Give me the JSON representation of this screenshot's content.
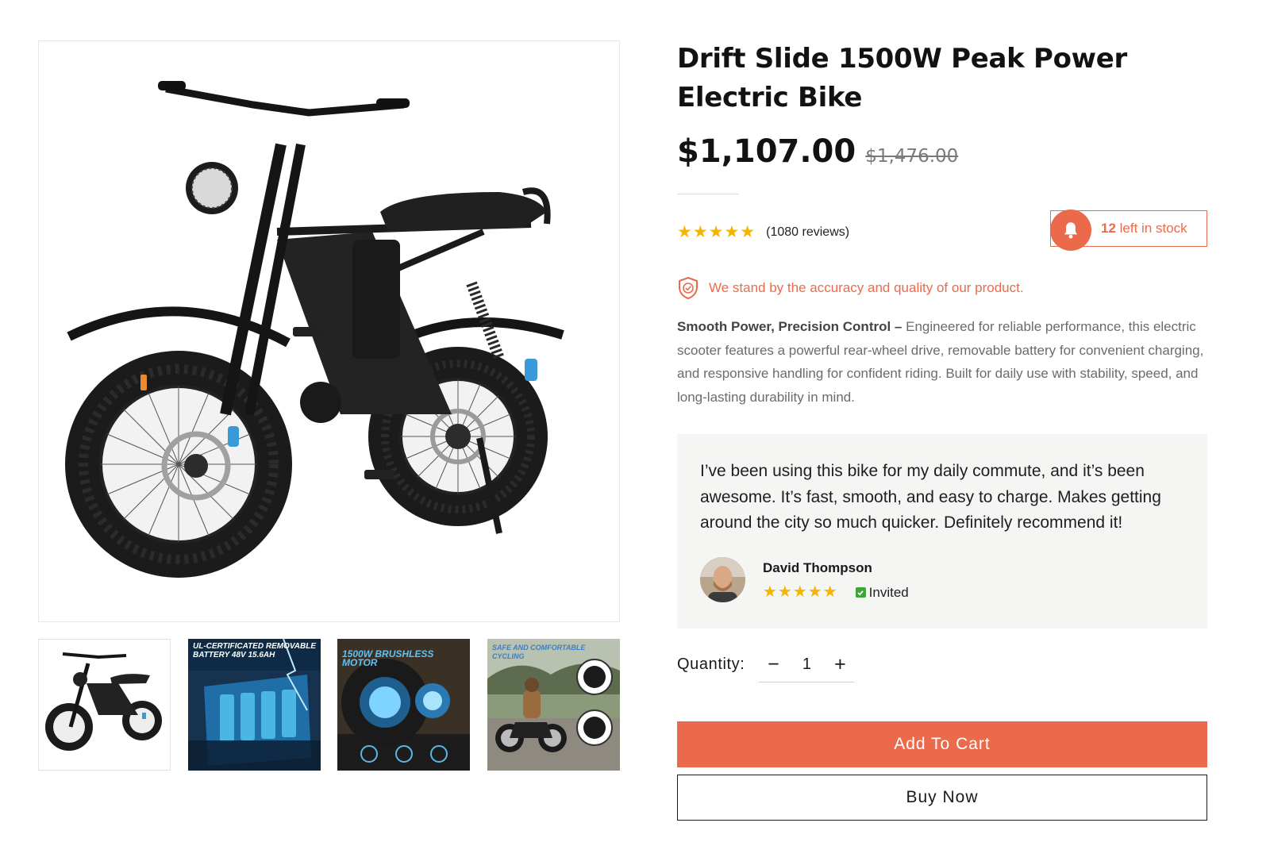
{
  "product": {
    "title": "Drift Slide 1500W Peak Power Electric Bike",
    "price": "$1,107.00",
    "compare_price": "$1,476.00"
  },
  "rating": {
    "stars": "★★★★★",
    "value": 5,
    "review_count": "(1080 reviews)"
  },
  "stock": {
    "count": "12",
    "text": " left in stock"
  },
  "trust": {
    "text": "We stand by the accuracy and quality of our product."
  },
  "description": {
    "lead": "Smooth Power, Precision Control –",
    "body": " Engineered for reliable performance, this electric scooter features a powerful rear-wheel drive, removable battery for convenient charging, and responsive handling for confident riding. Built for daily use with stability, speed, and long-lasting durability in mind."
  },
  "testimonial": {
    "quote": "I’ve been using this bike for my daily commute, and it’s been awesome. It’s fast, smooth, and easy to charge. Makes getting around the city so much quicker. Definitely recommend it!",
    "author": "David Thompson",
    "stars": "★★★★★",
    "badge": "Invited"
  },
  "quantity": {
    "label": "Quantity:",
    "value": "1",
    "minus": "−",
    "plus": "+"
  },
  "buttons": {
    "add_to_cart": "Add To Cart",
    "buy_now": "Buy Now"
  },
  "thumbnails": [
    {
      "caption": ""
    },
    {
      "caption": "UL-CERTIFICATED REMOVABLE BATTERY 48V 15.6AH"
    },
    {
      "caption": "1500W BRUSHLESS MOTOR"
    },
    {
      "caption": "SAFE AND COMFORTABLE CYCLING"
    }
  ],
  "colors": {
    "accent": "#ec6a4c",
    "star": "#f5b400",
    "text": "#121212",
    "muted": "#6b6b6b",
    "testimonial_bg": "#f5f5f4",
    "verified": "#3ca63c"
  },
  "icons": {
    "stock": "bell-icon",
    "trust": "shield-check-icon",
    "verified": "check-icon"
  }
}
